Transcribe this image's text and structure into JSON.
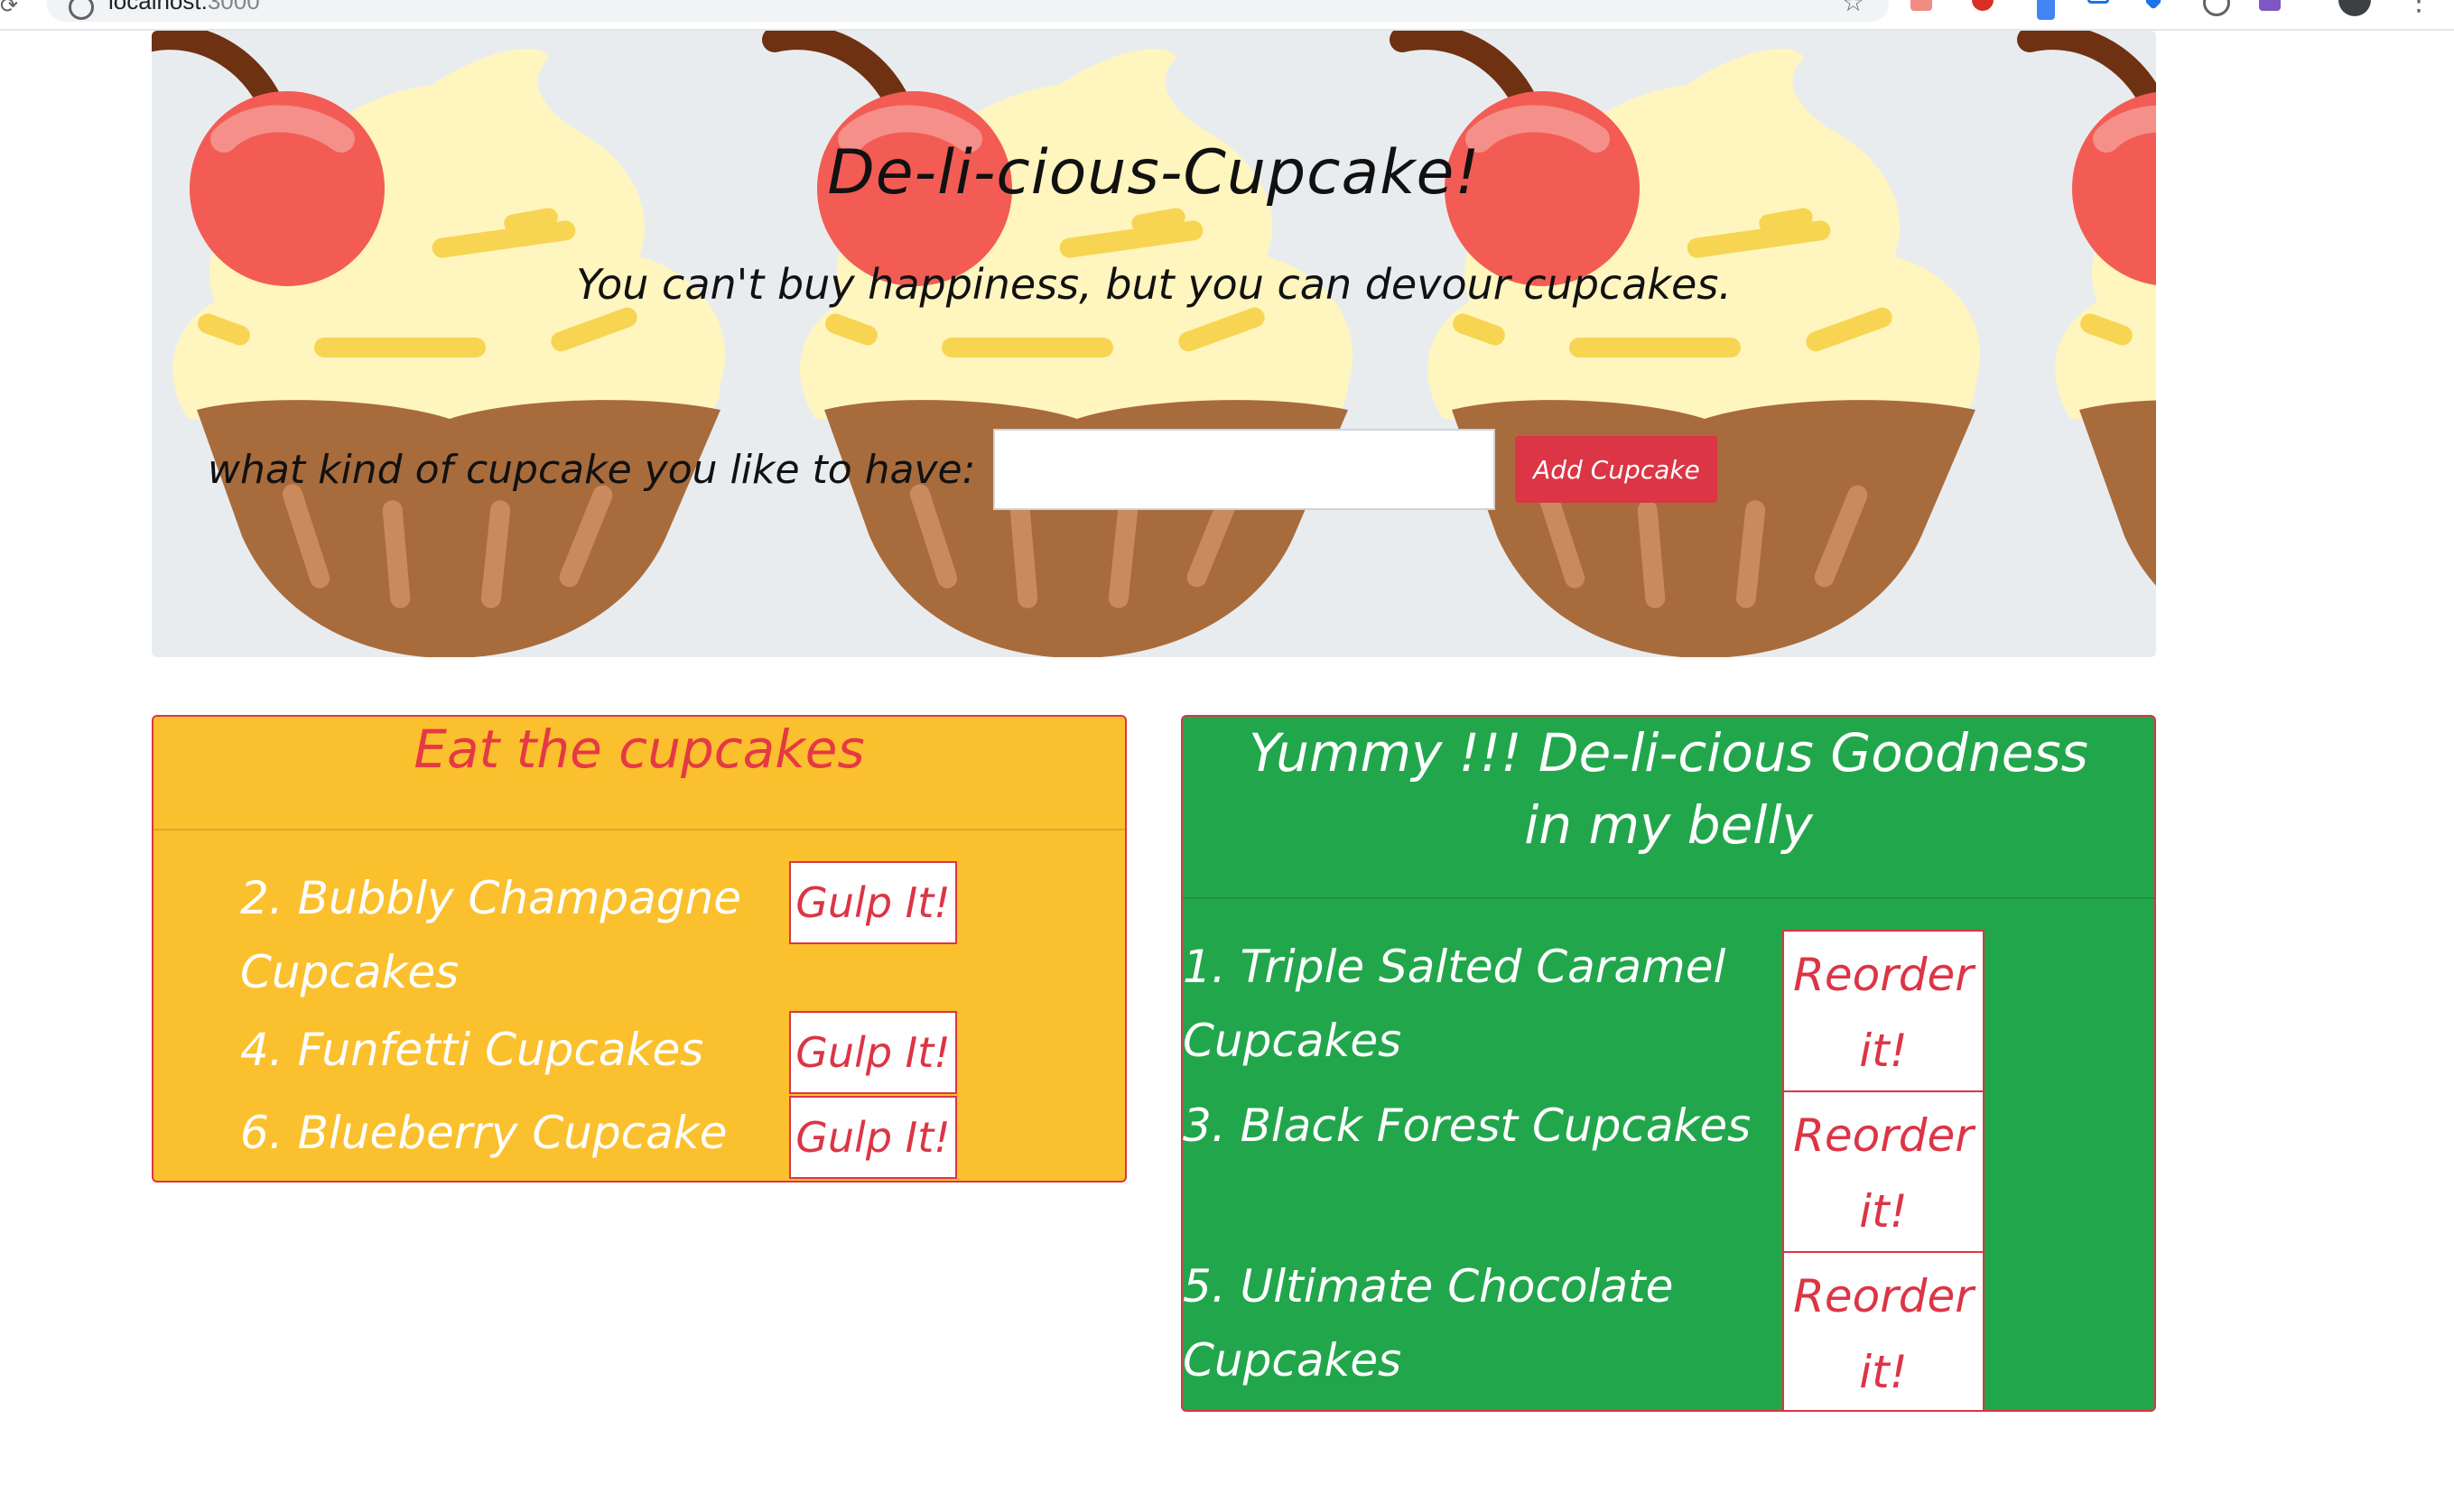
{
  "browser": {
    "url_host": "localhost:",
    "url_port": "3000"
  },
  "hero": {
    "title": "De-li-cious-Cupcake!",
    "tagline": "You can't buy happiness, but you can devour cupcakes.",
    "form_label": "what kind of cupcake you like to have:",
    "input_value": "",
    "input_placeholder": "",
    "add_button_label": "Add Cupcake"
  },
  "eat_list": {
    "header": "Eat the cupcakes",
    "button_label": "Gulp It!",
    "items": [
      {
        "label": "2. Bubbly Champagne Cupcakes"
      },
      {
        "label": "4. Funfetti Cupcakes"
      },
      {
        "label": "6. Blueberry Cupcake"
      }
    ]
  },
  "eaten_list": {
    "header": "Yummy !!! De-li-cious Goodness in my belly",
    "button_label": "Reorder it!",
    "items": [
      {
        "label": "1. Triple Salted Caramel Cupcakes"
      },
      {
        "label": "3. Black Forest Cupcakes"
      },
      {
        "label": "5. Ultimate Chocolate Cupcakes"
      }
    ]
  },
  "colors": {
    "jumbotron_bg": "#e9ecef",
    "eat_card_bg": "#fbc02d",
    "eaten_card_bg": "#22a64c",
    "accent_red": "#dc3545",
    "frosting": "#fff5bf",
    "cherry": "#f25c54",
    "wrapper": "#a86b3c"
  }
}
